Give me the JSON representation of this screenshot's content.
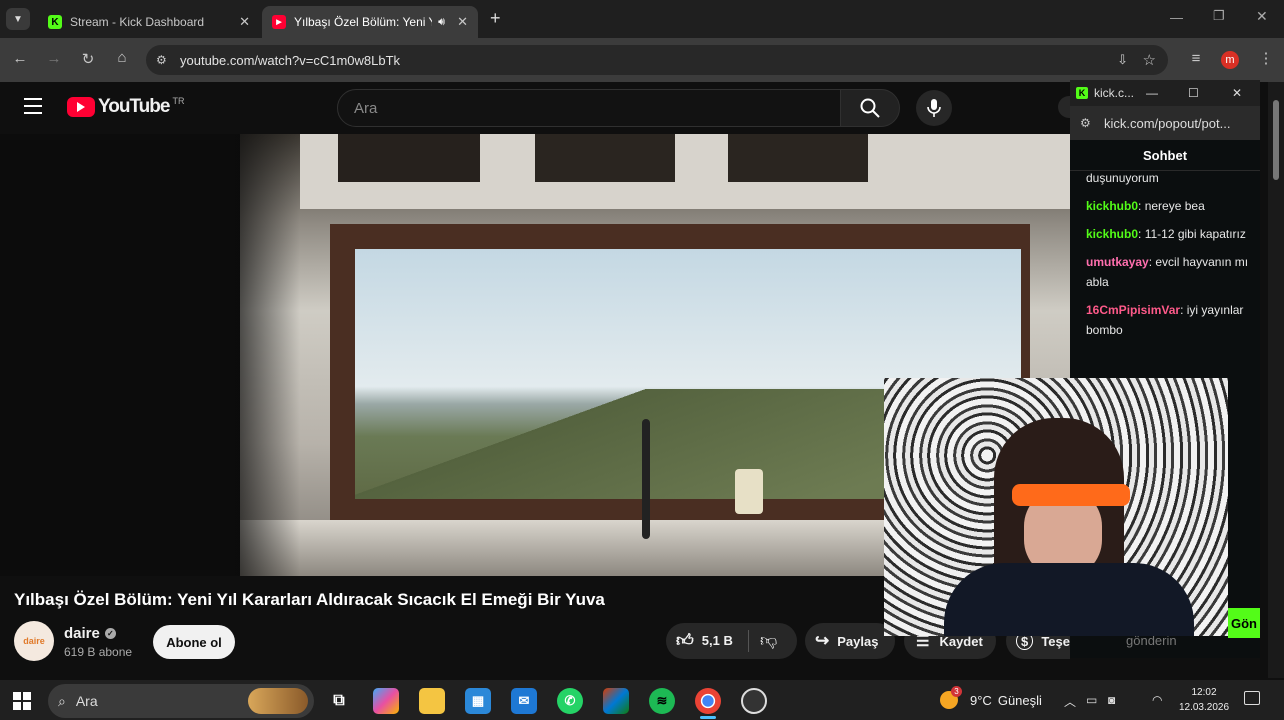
{
  "tabs": [
    {
      "title": "Stream - Kick Dashboard",
      "close": "✕"
    },
    {
      "title": "Yılbaşı Özel Bölüm: Yeni Yıl",
      "close": "✕"
    }
  ],
  "new_tab": "+",
  "profile_initial": "m",
  "address": {
    "url": "youtube.com/watch?v=cC1m0w8LbTk"
  },
  "youtube": {
    "logo_text": "YouTube",
    "region": "TR",
    "search_placeholder": "Ara",
    "video_title": "Yılbaşı Özel Bölüm: Yeni Yıl Kararları Aldıracak Sıcacık El Emeği Bir Yuva",
    "channel": {
      "name": "daire",
      "subscribers": "619 B abone",
      "avatar_text": "daire"
    },
    "subscribe_label": "Abone ol",
    "likes": "5,1 B",
    "share_label": "Paylaş",
    "save_label": "Kaydet",
    "thanks_label": "Teşe"
  },
  "kick": {
    "window_title": "kick.c...",
    "url": "kick.com/popout/pot...",
    "chat_header": "Sohbet",
    "messages": [
      {
        "user": "",
        "text": "duşunuyorum",
        "color": "#e8e8e8"
      },
      {
        "user": "kickhub0",
        "text": "nereye bea",
        "color": "#53fc18"
      },
      {
        "user": "kickhub0",
        "text": "11-12 gibi kapatırız",
        "color": "#53fc18"
      },
      {
        "user": "umutkayay",
        "text": "evcil hayvanın mı abla",
        "color": "#ff6fae"
      },
      {
        "user": "16CmPipisimVar",
        "text": "iyi yayınlar bombo",
        "color": "#ff5a8a"
      }
    ],
    "send_label": "Gön",
    "input_placeholder": "gönderin"
  },
  "taskbar": {
    "search_label": "Ara",
    "weather_temp": "9°C",
    "weather_text": "Güneşli",
    "weather_badge": "3",
    "time": "12:02",
    "date": "12.03.2026"
  },
  "colors": {
    "kick_green": "#53fc18",
    "yt_red": "#ff0033",
    "profile_red": "#d93025"
  }
}
